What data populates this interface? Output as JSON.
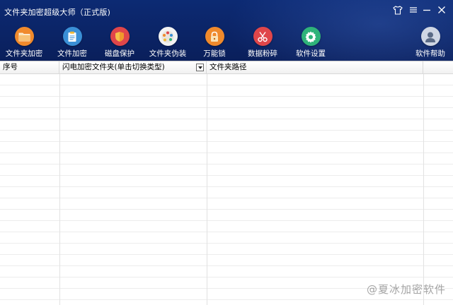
{
  "window": {
    "title": "文件夹加密超级大师（正式版)"
  },
  "toolbar": {
    "items": [
      {
        "label": "文件夹加密",
        "icon": "folder-icon",
        "color": "#f08a2c"
      },
      {
        "label": "文件加密",
        "icon": "document-icon",
        "color": "#3a8fd6"
      },
      {
        "label": "磁盘保护",
        "icon": "shield-icon",
        "color": "#e0464a"
      },
      {
        "label": "文件夹伪装",
        "icon": "palette-icon",
        "color": "#f3f3f3"
      },
      {
        "label": "万能锁",
        "icon": "lock-icon",
        "color": "#f08a2c"
      },
      {
        "label": "数据粉碎",
        "icon": "scissors-icon",
        "color": "#e0464a"
      },
      {
        "label": "软件设置",
        "icon": "gear-icon",
        "color": "#2fb37a"
      },
      {
        "label": "软件帮助",
        "icon": "user-icon",
        "color": "#cfd6e4"
      }
    ]
  },
  "table": {
    "columns": [
      {
        "label": "序号"
      },
      {
        "label": "闪电加密文件夹(单击切换类型)"
      },
      {
        "label": "文件夹路径"
      }
    ]
  },
  "watermark": "@夏冰加密软件"
}
